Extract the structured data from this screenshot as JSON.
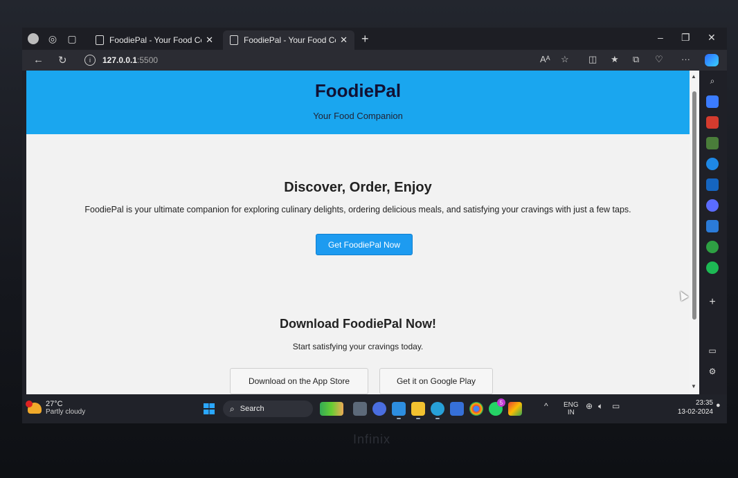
{
  "browser": {
    "tabs": [
      {
        "title": "FoodiePal - Your Food Companion",
        "active": false
      },
      {
        "title": "FoodiePal - Your Food Companion",
        "active": true
      }
    ],
    "new_tab_label": "+",
    "address": {
      "host": "127.0.0.1",
      "port": ":5500"
    },
    "window_controls": {
      "minimize": "–",
      "restore": "❐",
      "close": "✕"
    },
    "read_aloud_label": "Aᴬ"
  },
  "page": {
    "header": {
      "title": "FoodiePal",
      "tagline": "Your Food Companion"
    },
    "hero": {
      "title": "Discover, Order, Enjoy",
      "text": "FoodiePal is your ultimate companion for exploring culinary delights, ordering delicious meals, and satisfying your cravings with just a few taps.",
      "cta_label": "Get FoodiePal Now"
    },
    "download": {
      "title": "Download FoodiePal Now!",
      "text": "Start satisfying your cravings today.",
      "app_store_label": "Download on the App Store",
      "google_play_label": "Get it on Google Play"
    }
  },
  "taskbar": {
    "weather": {
      "temp": "27°C",
      "condition": "Partly cloudy",
      "alert_count": "1"
    },
    "search_label": "Search",
    "whatsapp_badge": "5",
    "language": {
      "line1": "ENG",
      "line2": "IN"
    },
    "time": "23:35",
    "date": "13-02-2024"
  },
  "device": {
    "brand": "Infinix"
  },
  "colors": {
    "header": "#1aa6ef",
    "cta": "#1d9bf0",
    "page_bg": "#f2f2f2"
  }
}
